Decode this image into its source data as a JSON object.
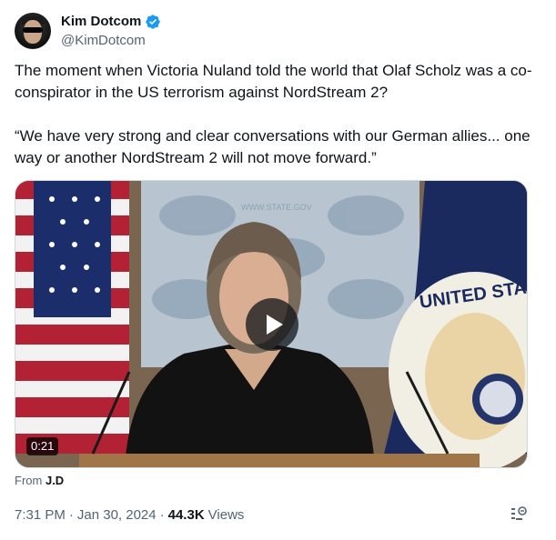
{
  "author": {
    "display_name": "Kim Dotcom",
    "handle": "@KimDotcom",
    "verified": true,
    "verified_color": "#1d9bf0"
  },
  "tweet": {
    "text": "The moment when Victoria Nuland told the world that Olaf Scholz was a co-conspirator in the US terrorism against NordStream 2?\n\n“We have very strong and clear conversations with our German allies... one way or another NordStream 2 will not move forward.”"
  },
  "video": {
    "duration": "0:21",
    "backdrop_watermark": "WWW.STATE.GOV",
    "seal_text": "UNITED STA"
  },
  "source": {
    "prefix": "From",
    "name": "J.D"
  },
  "meta": {
    "time": "7:31 PM",
    "date": "Jan 30, 2024",
    "separator": "·",
    "views_count": "44.3K",
    "views_label": "Views"
  },
  "icons": {
    "verified": "verified-badge-icon",
    "play": "play-icon",
    "grok": "grok-icon"
  }
}
